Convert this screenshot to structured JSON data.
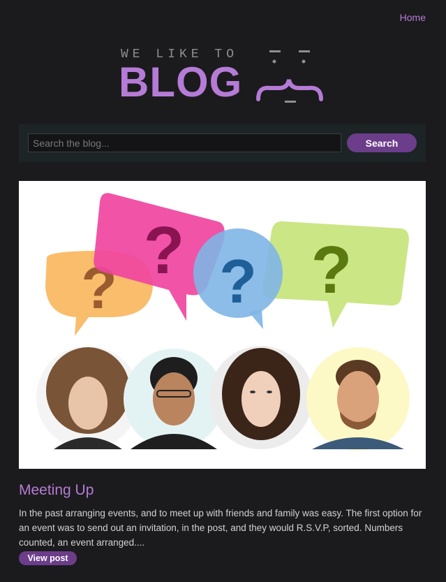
{
  "nav": {
    "home_label": "Home"
  },
  "logo": {
    "tagline": "WE LIKE TO",
    "word": "BLOG"
  },
  "search": {
    "placeholder": "Search the blog...",
    "value": "",
    "button_label": "Search"
  },
  "post": {
    "title": "Meeting Up",
    "excerpt": "In the past arranging events, and to meet up with friends and family was easy. The first option for an event was to send out an invitation, in the post, and they would R.S.V.P, sorted. Numbers counted, an event arranged....",
    "button_label": "View post",
    "image": {
      "bubbles": [
        {
          "color": "#f9b75e",
          "mark": "?"
        },
        {
          "color": "#f0449f",
          "mark": "?"
        },
        {
          "color": "#7fb5e6",
          "mark": "?"
        },
        {
          "color": "#c7e47a",
          "mark": "?"
        }
      ],
      "people": [
        "woman-voluminous-hair",
        "man-glasses",
        "woman-dark-hair",
        "man-beard"
      ]
    }
  },
  "colors": {
    "accent": "#b57bd6",
    "button": "#6c3d8a",
    "background": "#1b1b1d",
    "search_panel": "#1c2426"
  }
}
